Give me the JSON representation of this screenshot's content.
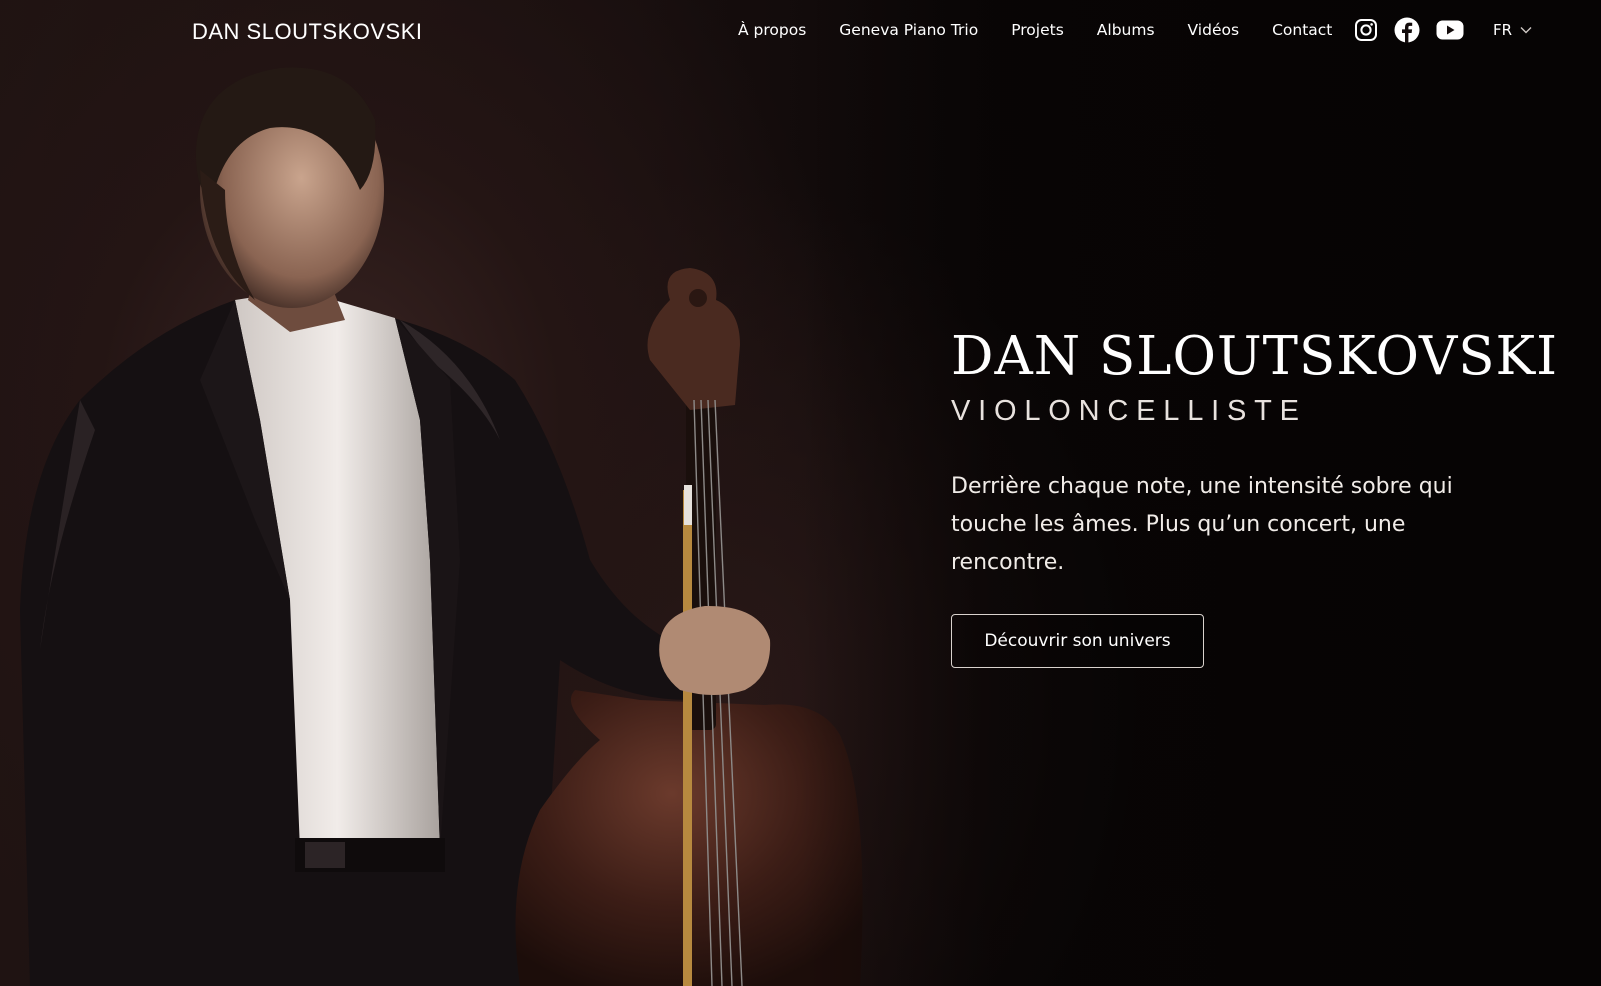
{
  "header": {
    "logo": "DAN SLOUTSKOVSKI",
    "nav": [
      {
        "label": "À propos"
      },
      {
        "label": "Geneva Piano Trio"
      },
      {
        "label": "Projets"
      },
      {
        "label": "Albums"
      },
      {
        "label": "Vidéos"
      },
      {
        "label": "Contact"
      }
    ],
    "socials": [
      {
        "icon": "instagram-icon"
      },
      {
        "icon": "facebook-icon"
      },
      {
        "icon": "youtube-icon"
      }
    ],
    "language": {
      "selected": "FR",
      "icon": "chevron-down-icon"
    }
  },
  "hero": {
    "title": "DAN SLOUTSKOVSKI",
    "subtitle": "VIOLONCELLISTE",
    "text": "Derrière chaque note, une intensité sobre qui touche les âmes. Plus qu’un concert,  une rencontre.",
    "cta_label": "Découvrir son univers",
    "image": "cellist-portrait-photo"
  },
  "colors": {
    "background": "#0b0707",
    "text": "#ffffff",
    "button_border": "#d9d2cd"
  }
}
